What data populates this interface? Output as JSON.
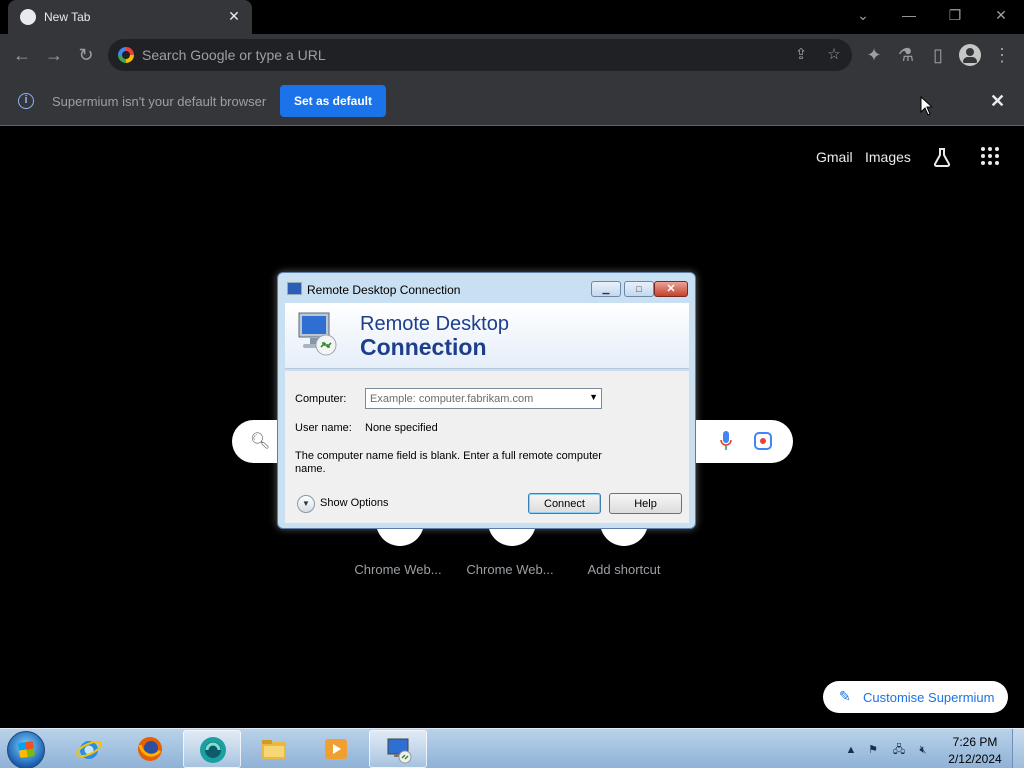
{
  "browser": {
    "tab_title": "New Tab",
    "omnibox_placeholder": "Search Google or type a URL",
    "infobar": {
      "message": "Supermium isn't your default browser",
      "button": "Set as default"
    }
  },
  "ntp": {
    "links": [
      "Gmail",
      "Images"
    ],
    "shortcuts": [
      "Chrome Web...",
      "Chrome Web...",
      "Add shortcut"
    ],
    "customise": "Customise Supermium"
  },
  "dialog": {
    "window_title": "Remote Desktop Connection",
    "banner_line1": "Remote Desktop",
    "banner_line2": "Connection",
    "computer_label": "Computer:",
    "computer_placeholder": "Example: computer.fabrikam.com",
    "username_label": "User name:",
    "username_value": "None specified",
    "message": "The computer name field is blank. Enter a full remote computer name.",
    "show_options": "Show Options",
    "connect_button": "Connect",
    "help_button": "Help"
  },
  "taskbar": {
    "time": "7:26 PM",
    "date": "2/12/2024"
  },
  "colors": {
    "accent": "#1a73e8",
    "toolbar": "#35363a",
    "dialog_frame": "#c9dff2"
  }
}
